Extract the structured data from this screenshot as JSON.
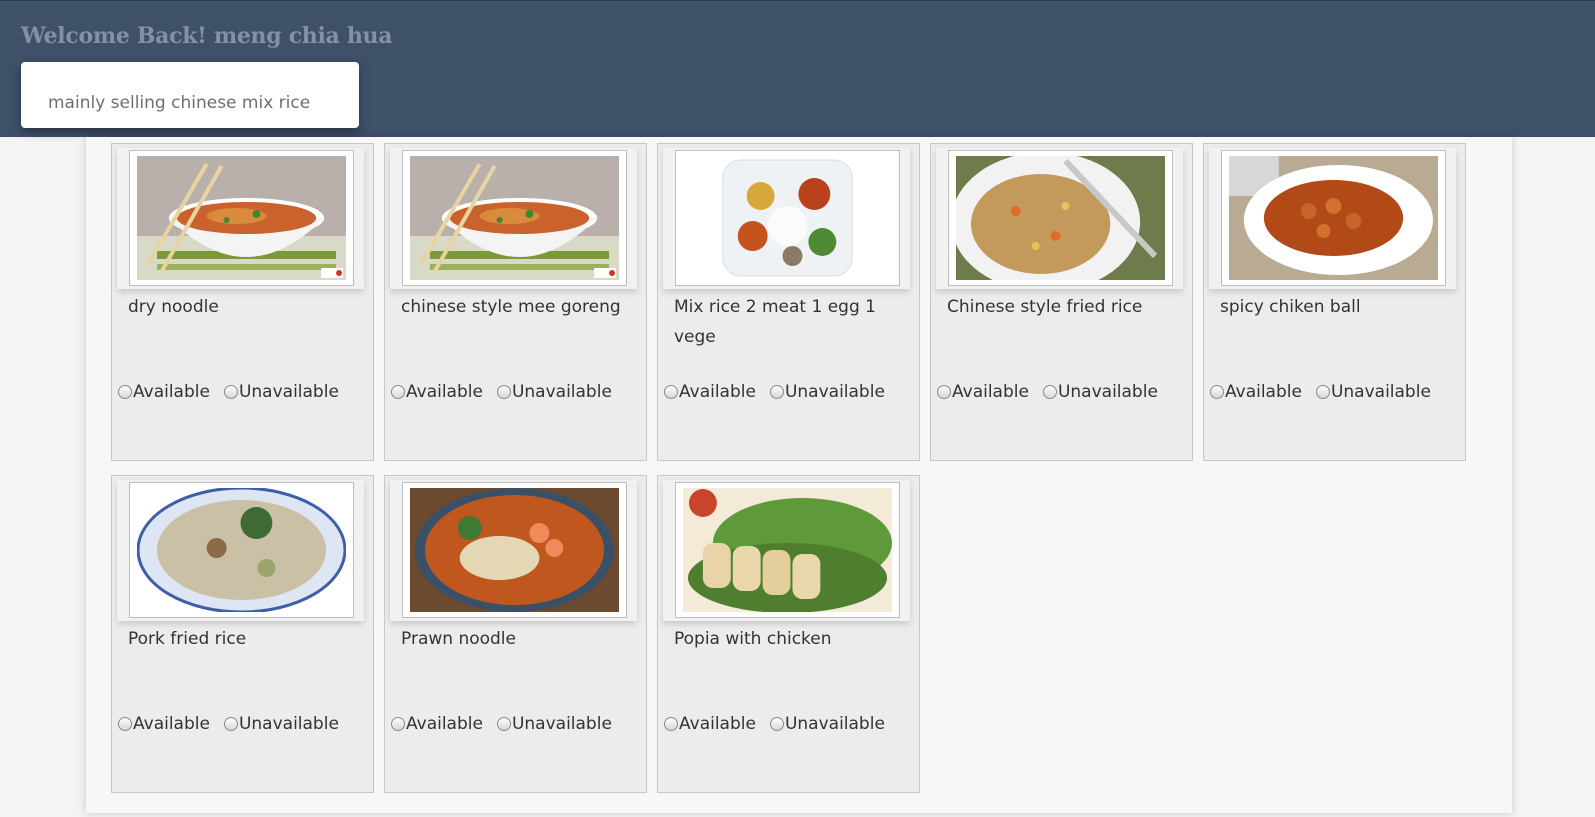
{
  "header": {
    "welcome": "Welcome Back! meng chia hua",
    "description": "mainly selling chinese mix rice"
  },
  "menu": {
    "option_available": "Available",
    "option_unavailable": "Unavailable",
    "items": [
      {
        "name": "dry noodle",
        "photo": "noodle-bowl"
      },
      {
        "name": "chinese style mee goreng",
        "photo": "noodle-bowl"
      },
      {
        "name": "Mix rice 2 meat 1 egg 1 vege",
        "photo": "mix-rice-plate"
      },
      {
        "name": "Chinese style fried rice",
        "photo": "fried-rice"
      },
      {
        "name": "spicy chiken ball",
        "photo": "chicken-ball"
      },
      {
        "name": "Pork fried rice",
        "photo": "pork-fried-rice"
      },
      {
        "name": "Prawn noodle",
        "photo": "prawn-noodle"
      },
      {
        "name": "Popia with chicken",
        "photo": "popia"
      }
    ]
  }
}
